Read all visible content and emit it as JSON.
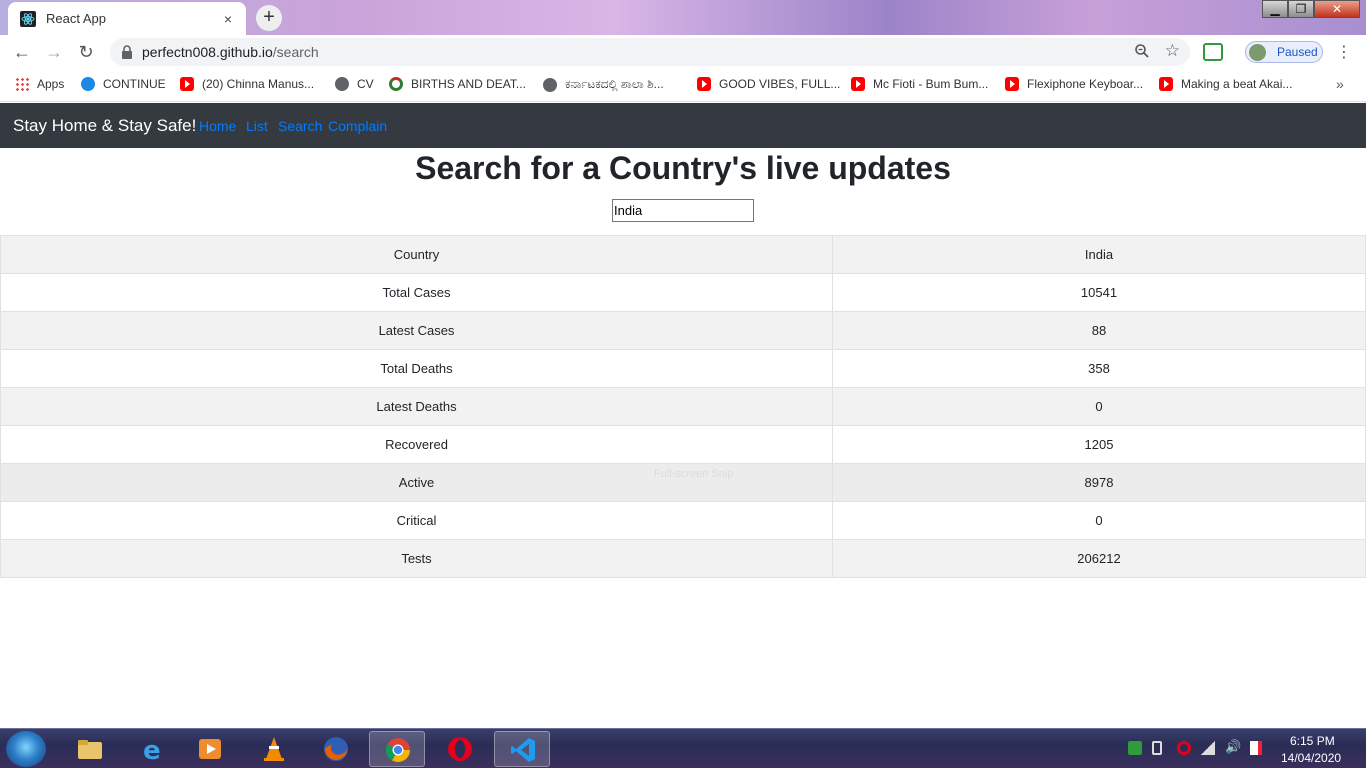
{
  "browser": {
    "tab_title": "React App",
    "tab_close": "×",
    "new_tab": "+",
    "window_controls": {
      "minimize": "▁",
      "maximize": "❐",
      "close": "✕"
    },
    "url_host": "perfectn008.github.io",
    "url_path": "/search",
    "profile_label": "Paused",
    "back": "←",
    "forward": "→",
    "reload": "↻",
    "menu": "⋮",
    "bookmarks": [
      {
        "label": "Apps",
        "icon": "apps-icon"
      },
      {
        "label": "CONTINUE",
        "icon": "download-icon"
      },
      {
        "label": "(20) Chinna Manus...",
        "icon": "youtube-icon"
      },
      {
        "label": "CV",
        "icon": "globe-icon"
      },
      {
        "label": "BIRTHS AND DEAT...",
        "icon": "births-icon"
      },
      {
        "label": "ಕರ್ನಾಟಕದಲ್ಲಿ ಶಾಲಾ ಶಿ...",
        "icon": "globe-icon"
      },
      {
        "label": "GOOD VIBES, FULL...",
        "icon": "youtube-icon"
      },
      {
        "label": "Mc Fioti - Bum Bum...",
        "icon": "youtube-icon"
      },
      {
        "label": "Flexiphone Keyboar...",
        "icon": "youtube-icon"
      },
      {
        "label": "Making a beat Akai...",
        "icon": "youtube-icon"
      }
    ],
    "bookmarks_more": "»"
  },
  "app": {
    "brand": "Stay Home & Stay Safe!",
    "nav": [
      "Home",
      "List",
      "Search",
      "Complain"
    ],
    "heading": "Search for a Country's live updates",
    "search_value": "India",
    "stats": [
      {
        "label": "Country",
        "value": "India"
      },
      {
        "label": "Total Cases",
        "value": "10541"
      },
      {
        "label": "Latest Cases",
        "value": "88"
      },
      {
        "label": "Total Deaths",
        "value": "358"
      },
      {
        "label": "Latest Deaths",
        "value": "0"
      },
      {
        "label": "Recovered",
        "value": "1205"
      },
      {
        "label": "Active",
        "value": "8978"
      },
      {
        "label": "Critical",
        "value": "0"
      },
      {
        "label": "Tests",
        "value": "206212"
      }
    ],
    "watermark": "Full-screen Snip"
  },
  "taskbar": {
    "apps": [
      "file-explorer",
      "internet-explorer",
      "media-player",
      "vlc",
      "firefox",
      "chrome",
      "opera",
      "vscode"
    ],
    "active_app": "chrome",
    "time": "6:15 PM",
    "date": "14/04/2020"
  },
  "colors": {
    "navbar": "#343a40",
    "link": "#007bff",
    "stripe": "#f2f2f2"
  }
}
